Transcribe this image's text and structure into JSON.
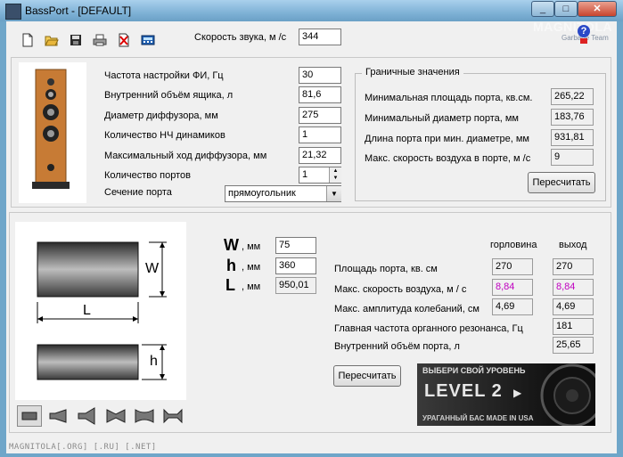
{
  "window": {
    "title": "BassPort - [DEFAULT]"
  },
  "watermark": {
    "brand": "MAGNITOLA",
    "sub": "Garbage Team"
  },
  "toolbar": {
    "icons": [
      "new-file-icon",
      "open-folder-icon",
      "save-disk-icon",
      "print-icon",
      "delete-icon",
      "calculator-icon"
    ],
    "sound_speed_label": "Скорость звука, м /с",
    "sound_speed_value": "344"
  },
  "params": {
    "tuning_freq": {
      "label": "Частота настройки ФИ, Гц",
      "value": "30"
    },
    "box_volume": {
      "label": "Внутренний объём ящика, л",
      "value": "81,6"
    },
    "cone_diameter": {
      "label": "Диаметр диффузора, мм",
      "value": "275"
    },
    "woofer_count": {
      "label": "Количество НЧ динамиков",
      "value": "1"
    },
    "max_excursion": {
      "label": "Максимальный ход диффузора, мм",
      "value": "21,32"
    },
    "port_count": {
      "label": "Количество портов",
      "value": "1"
    },
    "port_section": {
      "label": "Сечение порта",
      "value": "прямоугольник"
    }
  },
  "limits": {
    "title": "Граничные значения",
    "min_area": {
      "label": "Минимальная площадь порта, кв.см.",
      "value": "265,22"
    },
    "min_diameter": {
      "label": "Минимальный диаметр порта, мм",
      "value": "183,76"
    },
    "len_at_min_diameter": {
      "label": "Длина порта при мин. диаметре, мм",
      "value": "931,81"
    },
    "max_air_speed": {
      "label": "Макс. скорость воздуха в порте, м /с",
      "value": "9"
    },
    "recalc_label": "Пересчитать"
  },
  "dims": {
    "w": {
      "letter": "W",
      "unit": ", мм",
      "value": "75"
    },
    "h": {
      "letter": "h",
      "unit": ", мм",
      "value": "360"
    },
    "l": {
      "letter": "L",
      "unit": ", мм",
      "value": "950,01"
    },
    "diagram_w": "W",
    "diagram_l": "L",
    "diagram_h": "h"
  },
  "results": {
    "col_throat": "горловина",
    "col_exit": "выход",
    "rows": [
      {
        "label": "Площадь порта, кв. см",
        "throat": "270",
        "exit": "270"
      },
      {
        "label": "Макс. скорость воздуха, м / с",
        "throat": "8,84",
        "exit": "8,84"
      },
      {
        "label": "Макс. амплитуда колебаний, см",
        "throat": "4,69",
        "exit": "4,69"
      },
      {
        "label": "Главная частота органного резонанса, Гц",
        "exit": "181"
      },
      {
        "label": "Внутренний объём порта, л",
        "exit": "25,65"
      }
    ],
    "recalc_label": "Пересчитать"
  },
  "banner": {
    "top": "ВЫБЕРИ СВОЙ УРОВЕНЬ",
    "level": "LEVEL 2",
    "bottom": "УРАГАННЫЙ БАС MADE IN USA"
  },
  "status": "MAGNITOLA[.ORG] [.RU] [.NET]"
}
